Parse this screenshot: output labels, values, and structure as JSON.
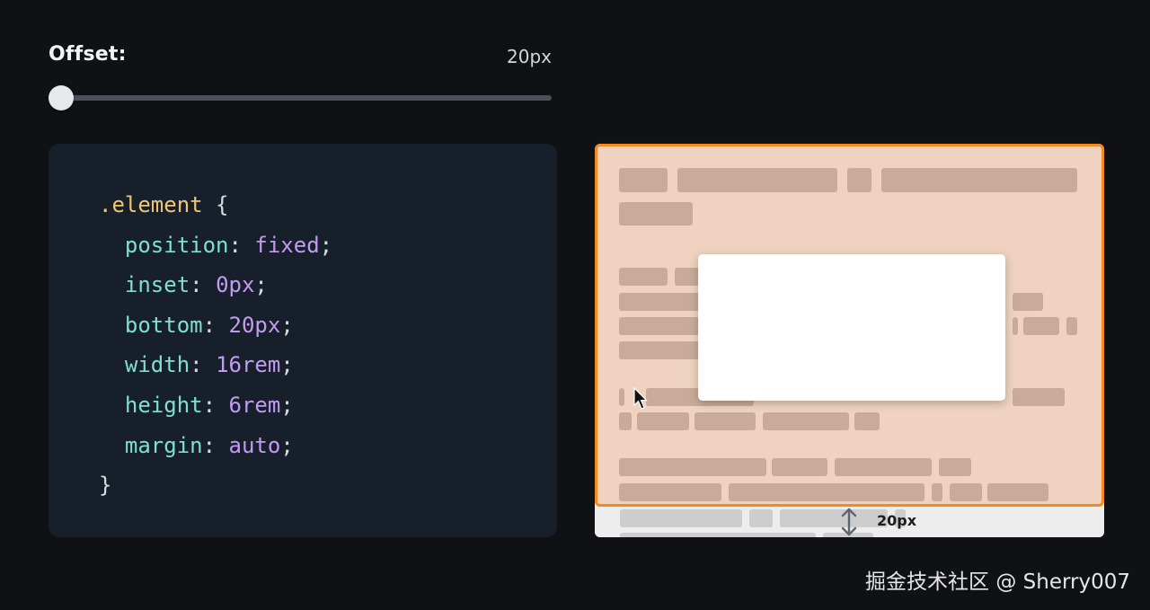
{
  "slider": {
    "label": "Offset:",
    "value_text": "20px",
    "value_fraction": 0.0
  },
  "code": {
    "selector": ".element",
    "open_brace": "{",
    "close_brace": "}",
    "declarations": [
      {
        "property": "position",
        "value": "fixed"
      },
      {
        "property": "inset",
        "value": "0px"
      },
      {
        "property": "bottom",
        "value": "20px"
      },
      {
        "property": "width",
        "value": "16rem"
      },
      {
        "property": "height",
        "value": "6rem"
      },
      {
        "property": "margin",
        "value": "auto"
      }
    ],
    "colon": ":",
    "semicolon": ";"
  },
  "preview": {
    "offset_label": "20px",
    "frame_color": "#f28b1e",
    "overlay_color": "#efd3c0"
  },
  "watermark": "掘金技术社区 @ Sherry007"
}
